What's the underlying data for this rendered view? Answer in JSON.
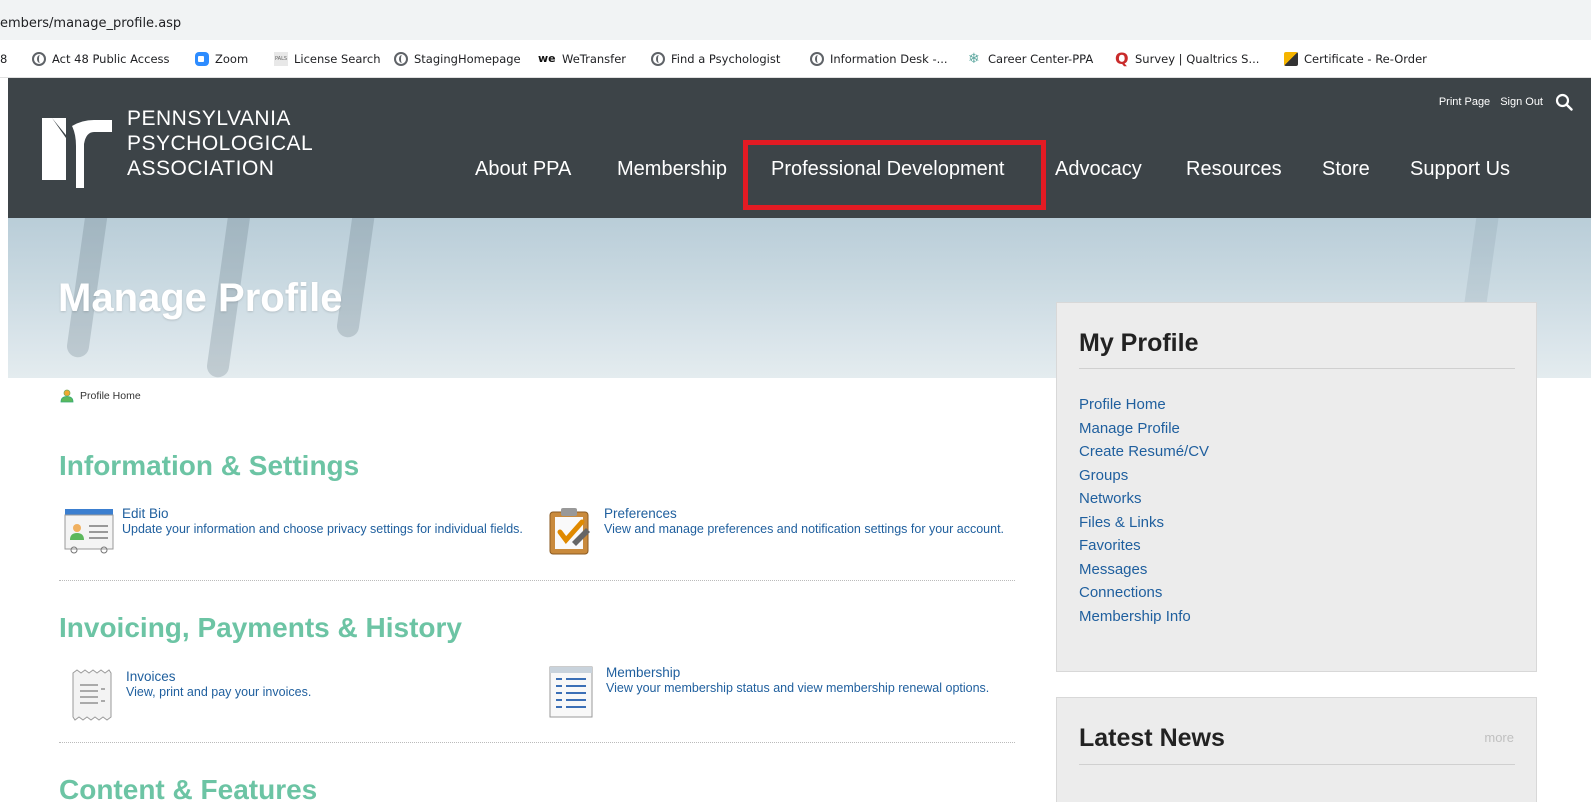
{
  "browser": {
    "url": "embers/manage_profile.asp",
    "bookmarks": [
      {
        "label": "8",
        "icon": "none"
      },
      {
        "label": "Act 48 Public Access",
        "icon": "globe-icon"
      },
      {
        "label": "Zoom",
        "icon": "zoom-icon"
      },
      {
        "label": "License Search",
        "icon": "pals-icon"
      },
      {
        "label": "StagingHomepage",
        "icon": "globe-icon"
      },
      {
        "label": "WeTransfer",
        "icon": "wetransfer-icon"
      },
      {
        "label": "Find a Psychologist",
        "icon": "globe-icon"
      },
      {
        "label": "Information Desk -...",
        "icon": "globe-icon"
      },
      {
        "label": "Career Center-PPA",
        "icon": "career-icon"
      },
      {
        "label": "Survey | Qualtrics S...",
        "icon": "qualtrics-icon"
      },
      {
        "label": "Certificate - Re-Order",
        "icon": "certificate-icon"
      }
    ]
  },
  "header": {
    "logo_lines": [
      "PENNSYLVANIA",
      "PSYCHOLOGICAL",
      "ASSOCIATION"
    ],
    "utility": {
      "print": "Print Page",
      "signout": "Sign Out"
    },
    "nav": [
      "About PPA",
      "Membership",
      "Professional Development",
      "Advocacy",
      "Resources",
      "Store",
      "Support Us"
    ],
    "highlight_color": "#e31b23"
  },
  "hero": {
    "title": "Manage Profile"
  },
  "breadcrumb": {
    "label": "Profile Home"
  },
  "sections": {
    "info": {
      "title": "Information & Settings",
      "items": [
        {
          "title": "Edit Bio",
          "desc": "Update your information and choose privacy settings for individual fields."
        },
        {
          "title": "Preferences",
          "desc": "View and manage preferences and notification settings for your account."
        }
      ]
    },
    "invoicing": {
      "title": "Invoicing, Payments & History",
      "items": [
        {
          "title": "Invoices",
          "desc": "View, print and pay your invoices."
        },
        {
          "title": "Membership",
          "desc": "View your membership status and view membership renewal options."
        }
      ]
    },
    "content": {
      "title": "Content & Features"
    }
  },
  "sidebar": {
    "profile": {
      "title": "My Profile",
      "links": [
        "Profile Home",
        "Manage Profile",
        "Create Resumé/CV",
        "Groups",
        "Networks",
        "Files & Links",
        "Favorites",
        "Messages",
        "Connections",
        "Membership Info"
      ]
    },
    "news": {
      "title": "Latest News",
      "more": "more"
    }
  },
  "colors": {
    "accent_green": "#6cc4a4",
    "link_blue": "#1f5f9e",
    "header_bg": "#3d4448"
  }
}
